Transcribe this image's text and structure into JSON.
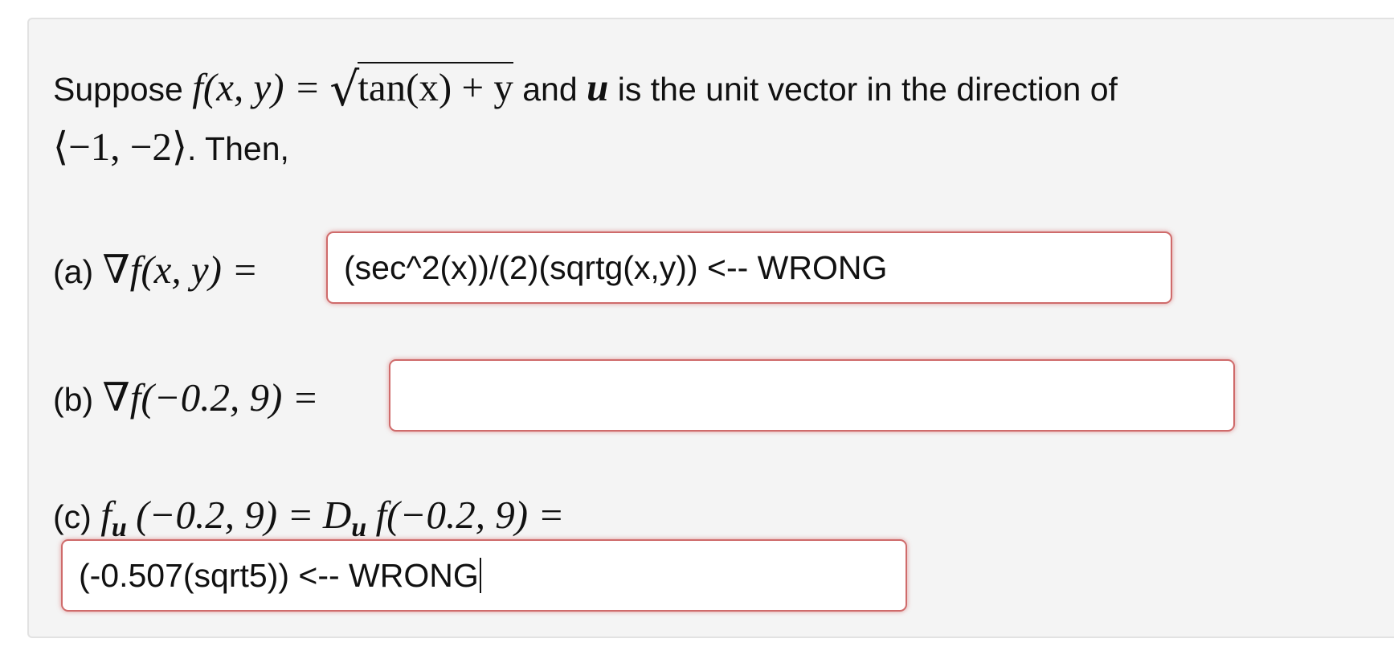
{
  "problem": {
    "intro_word": "Suppose",
    "function_lhs": "f(x, y) =",
    "radicand": "tan(x) + y",
    "and_text": "and",
    "vector_symbol": "u",
    "rest_text": "is the unit vector in the direction of",
    "direction_vector": "⟨−1, −2⟩",
    "then_text": ". Then,"
  },
  "parts": {
    "a": {
      "label": "(a)",
      "expression": "∇f(x, y) =",
      "answer": "(sec^2(x))/(2)(sqrtg(x,y)) <-- WRONG"
    },
    "b": {
      "label": "(b)",
      "expression": "∇f(−0.2, 9) =",
      "answer": ""
    },
    "c": {
      "label": "(c)",
      "f_symbol": "f",
      "subscript": "u",
      "point1": "(−0.2, 9) =",
      "D_symbol": "D",
      "point2": "f(−0.2, 9) =",
      "answer": "(-0.507(sqrt5)) <-- WRONG"
    }
  },
  "colors": {
    "panel_bg": "#f4f4f4",
    "invalid_border": "#cf6b6b"
  }
}
